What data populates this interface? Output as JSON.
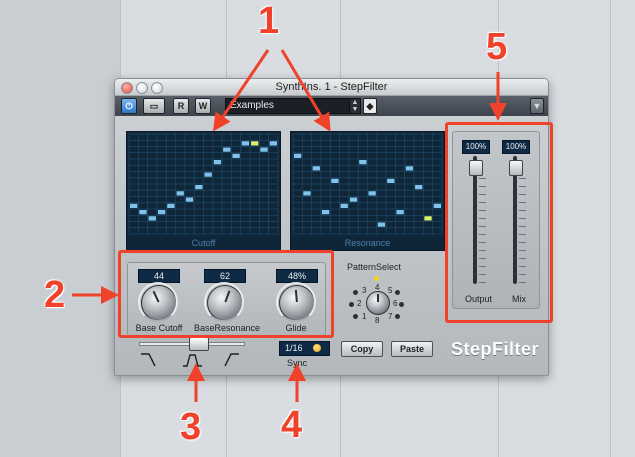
{
  "window": {
    "title": "SynthIns. 1 - StepFilter"
  },
  "toolbar": {
    "power_label": "",
    "bypass_label": "",
    "read_label": "R",
    "write_label": "W",
    "preset_value": "Examples"
  },
  "grids": {
    "cutoff_label": "Cutoff",
    "resonance_label": "Resonance"
  },
  "knobs": {
    "base_cutoff": {
      "value": "44",
      "label": "Base Cutoff"
    },
    "base_resonance": {
      "value": "62",
      "label": "BaseResonance"
    },
    "glide": {
      "value": "48%",
      "label": "Glide"
    }
  },
  "pattern": {
    "label": "PatternSelect",
    "numbers": [
      "1",
      "2",
      "3",
      "4",
      "5",
      "6",
      "7",
      "8"
    ]
  },
  "sync": {
    "value": "1/16",
    "label": "Sync"
  },
  "buttons": {
    "copy": "Copy",
    "paste": "Paste"
  },
  "sliders": {
    "output": {
      "value": "100%",
      "label": "Output",
      "level": 1.0
    },
    "mix": {
      "value": "100%",
      "label": "Mix",
      "level": 1.0
    }
  },
  "brand": "StepFilter",
  "annotations": [
    "1",
    "2",
    "3",
    "4",
    "5"
  ],
  "colors": {
    "annotation": "#f0412b",
    "grid_bg": "#0f2638",
    "step": "#7fc3ec",
    "step_active": "#d8f06a"
  }
}
